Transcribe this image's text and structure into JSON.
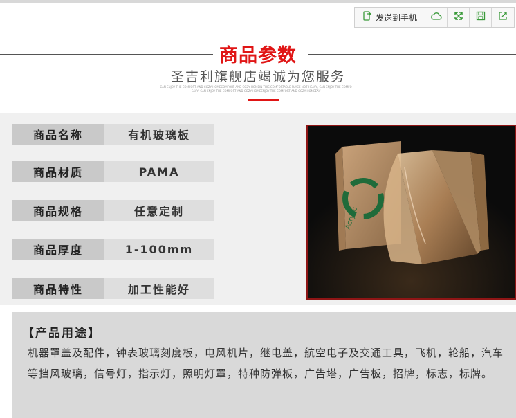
{
  "toolbar": {
    "send_label": "发送到手机",
    "icons": [
      "phone-send-icon",
      "cloud-icon",
      "expand-icon",
      "save-icon",
      "share-icon"
    ]
  },
  "header": {
    "title": "商品参数",
    "subtitle": "圣吉利旗舰店竭诚为您服务",
    "tagline_1": "CAN ENJOY THE COMFORT AND COZY HOMECOMFORT AND COZY HOMEIN THIS COMFORTABLE PLACE NOT HEAVY, CAN ENJOY THE COMFO",
    "tagline_2": "EAVY, CAN ENJOY THE COMFORT AND COZY HOMEENJOY THE COMFORT AND COZY HOMEEAV"
  },
  "specs": [
    {
      "label": "商品名称",
      "value": "有机玻璃板"
    },
    {
      "label": "商品材质",
      "value": "PAMA"
    },
    {
      "label": "商品规格",
      "value": "任意定制"
    },
    {
      "label": "商品厚度",
      "value": "1-100mm"
    },
    {
      "label": "商品特性",
      "value": "加工性能好"
    }
  ],
  "product_image": {
    "stamp_text": "Acrylic"
  },
  "usage": {
    "title": "【产品用途】",
    "text": "机器罩盖及配件，钟表玻璃刻度板，电风机片，继电盖，航空电子及交通工具，飞机，轮船，汽车等挡风玻璃，信号灯，指示灯，照明灯罩，特种防弹板，广告塔，广告板，招牌，标志，标牌。"
  },
  "colors": {
    "accent_red": "#e01515",
    "label_gray": "#c9c9c9",
    "value_gray": "#dedede",
    "icon_green": "#3a9a3a"
  }
}
